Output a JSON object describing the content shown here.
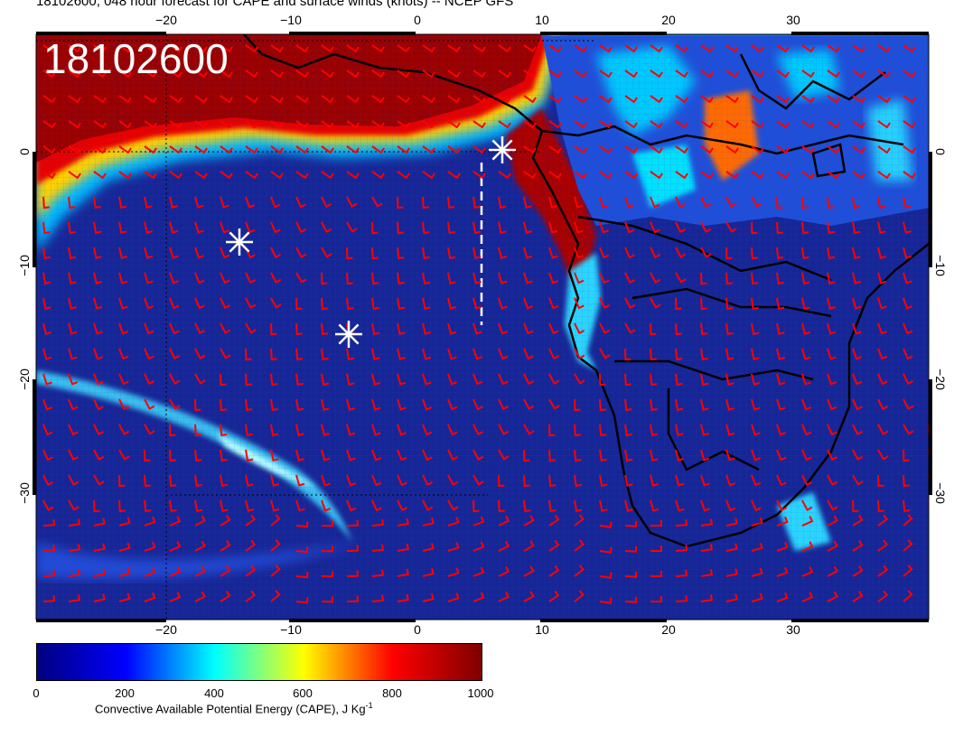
{
  "title": "18102600, 048 hour forecast for CAPE and surface winds (knots) -- NCEP GFS",
  "stamp": "18102600",
  "axes": {
    "lon_ticks": [
      "−20",
      "−10",
      "0",
      "10",
      "20",
      "30"
    ],
    "lat_ticks_left": [
      "0",
      "−10",
      "−20",
      "−30"
    ],
    "lat_ticks_right": [
      "0",
      "−10",
      "−20",
      "−30"
    ]
  },
  "colorbar": {
    "labels": [
      "0",
      "200",
      "400",
      "600",
      "800",
      "1000"
    ],
    "title": "Convective Available Potential Energy (CAPE), J Kg",
    "unit_sup": "-1",
    "colors": [
      "#00007f",
      "#0000ff",
      "#00ffff",
      "#ffff00",
      "#ff0000",
      "#7f0000"
    ]
  },
  "colors": {
    "ocean": "#1a2a9a",
    "wind_barb": "#ff0000",
    "coastline": "#000000",
    "marker": "#ffffff"
  },
  "markers": [
    "asterisk",
    "asterisk",
    "asterisk"
  ]
}
